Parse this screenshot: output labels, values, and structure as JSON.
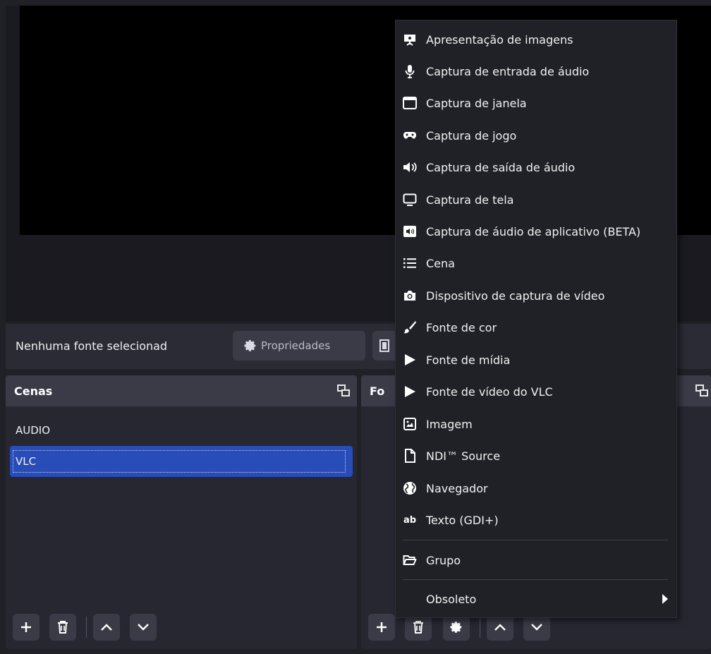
{
  "context_bar": {
    "no_source_label": "Nenhuma fonte selecionad",
    "properties_label": "Propriedades"
  },
  "scenes_panel": {
    "title": "Cenas",
    "items": [
      {
        "label": "AUDIO",
        "selected": false
      },
      {
        "label": "VLC",
        "selected": true
      }
    ]
  },
  "sources_panel": {
    "title_partial": "Fo"
  },
  "add_source_menu": {
    "items": [
      {
        "label": "Apresentação de imagens",
        "icon": "slideshow-icon"
      },
      {
        "label": "Captura de entrada de áudio",
        "icon": "microphone-icon"
      },
      {
        "label": "Captura de janela",
        "icon": "window-icon"
      },
      {
        "label": "Captura de jogo",
        "icon": "gamepad-icon"
      },
      {
        "label": "Captura de saída de áudio",
        "icon": "speaker-icon"
      },
      {
        "label": "Captura de tela",
        "icon": "monitor-icon"
      },
      {
        "label": "Captura de áudio de aplicativo (BETA)",
        "icon": "app-audio-icon"
      },
      {
        "label": "Cena",
        "icon": "list-icon"
      },
      {
        "label": "Dispositivo de captura de vídeo",
        "icon": "camera-icon"
      },
      {
        "label": "Fonte de cor",
        "icon": "brush-icon"
      },
      {
        "label": "Fonte de mídia",
        "icon": "play-icon"
      },
      {
        "label": "Fonte de vídeo do VLC",
        "icon": "play-icon"
      },
      {
        "label": "Imagem",
        "icon": "image-icon"
      },
      {
        "label": "NDI™ Source",
        "icon": "file-icon"
      },
      {
        "label": "Navegador",
        "icon": "globe-icon"
      },
      {
        "label": "Texto (GDI+)",
        "icon": "text-ab-icon"
      }
    ],
    "group_label": "Grupo",
    "deprecated_label": "Obsoleto",
    "ab_text": "ab"
  },
  "colors": {
    "selected_scene": "#284cb8",
    "panel_header": "#3a3b47",
    "background": "#202027"
  }
}
